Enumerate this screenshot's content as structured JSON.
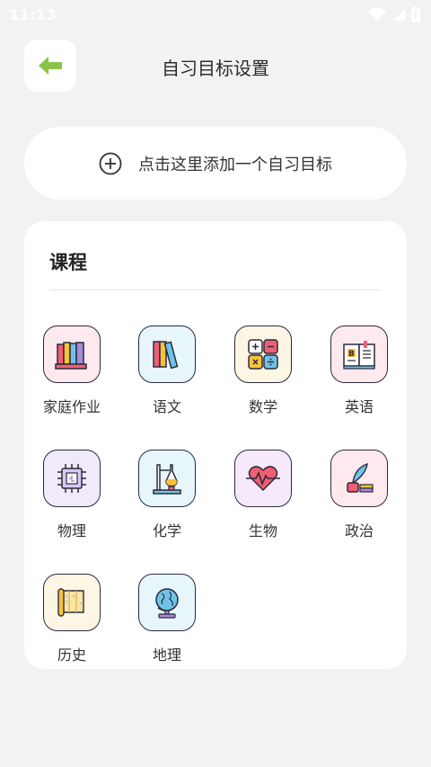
{
  "status_bar": {
    "time": "11:13"
  },
  "header": {
    "title": "自习目标设置"
  },
  "add_goal": {
    "label": "点击这里添加一个自习目标"
  },
  "course_section": {
    "title": "课程",
    "subjects": [
      {
        "label": "家庭作业",
        "icon": "homework-books-icon",
        "bg": "#fde9ee"
      },
      {
        "label": "语文",
        "icon": "chinese-books-icon",
        "bg": "#e6f6fb"
      },
      {
        "label": "数学",
        "icon": "math-calculator-icon",
        "bg": "#fdf6e4"
      },
      {
        "label": "英语",
        "icon": "english-book-icon",
        "bg": "#fde9ee"
      },
      {
        "label": "物理",
        "icon": "physics-chip-icon",
        "bg": "#f0eafb"
      },
      {
        "label": "化学",
        "icon": "chemistry-flask-icon",
        "bg": "#e6f6fb"
      },
      {
        "label": "生物",
        "icon": "biology-heart-icon",
        "bg": "#f5e9fb"
      },
      {
        "label": "政治",
        "icon": "politics-quill-icon",
        "bg": "#fde9ee"
      },
      {
        "label": "历史",
        "icon": "history-scroll-icon",
        "bg": "#fdf6e4"
      },
      {
        "label": "地理",
        "icon": "geography-globe-icon",
        "bg": "#e6f6fb"
      }
    ]
  },
  "colors": {
    "accent_green": "#8bc34a",
    "background": "#f2f2f0",
    "card": "#ffffff"
  }
}
